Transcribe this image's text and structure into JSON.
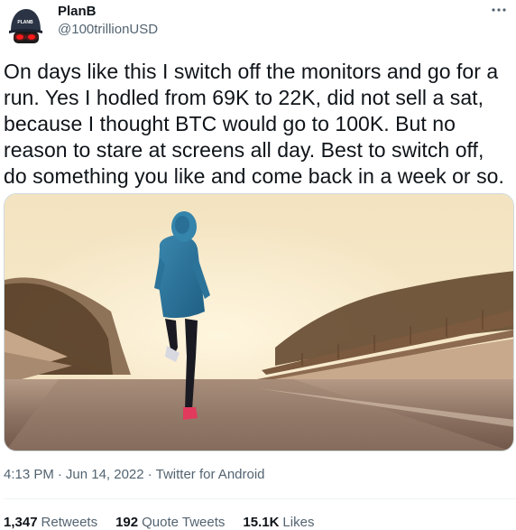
{
  "author": {
    "display_name": "PlanB",
    "handle": "@100trillionUSD",
    "avatar_text": "PLANB"
  },
  "tweet": {
    "text": "On days like this I switch off the monitors and go for a\nrun. Yes I hodled from 69K to 22K, did not sell a sat,\nbecause I thought BTC would go to 100K. But no\nreason to stare at screens all day. Best to switch off,\ndo something you like and come back in a week or so."
  },
  "meta": {
    "time": "4:13 PM",
    "separator": "·",
    "date": "Jun 14, 2022",
    "source": "Twitter for Android"
  },
  "stats": {
    "retweets_count": "1,347",
    "retweets_label": "Retweets",
    "quotes_count": "192",
    "quotes_label": "Quote Tweets",
    "likes_count": "15.1K",
    "likes_label": "Likes"
  },
  "colors": {
    "text_primary": "#0f1419",
    "text_secondary": "#536471",
    "divider": "#eff3f4",
    "avatar_eyes": "#ff1a1a"
  },
  "icons": {
    "more": "more-horizontal-icon"
  }
}
